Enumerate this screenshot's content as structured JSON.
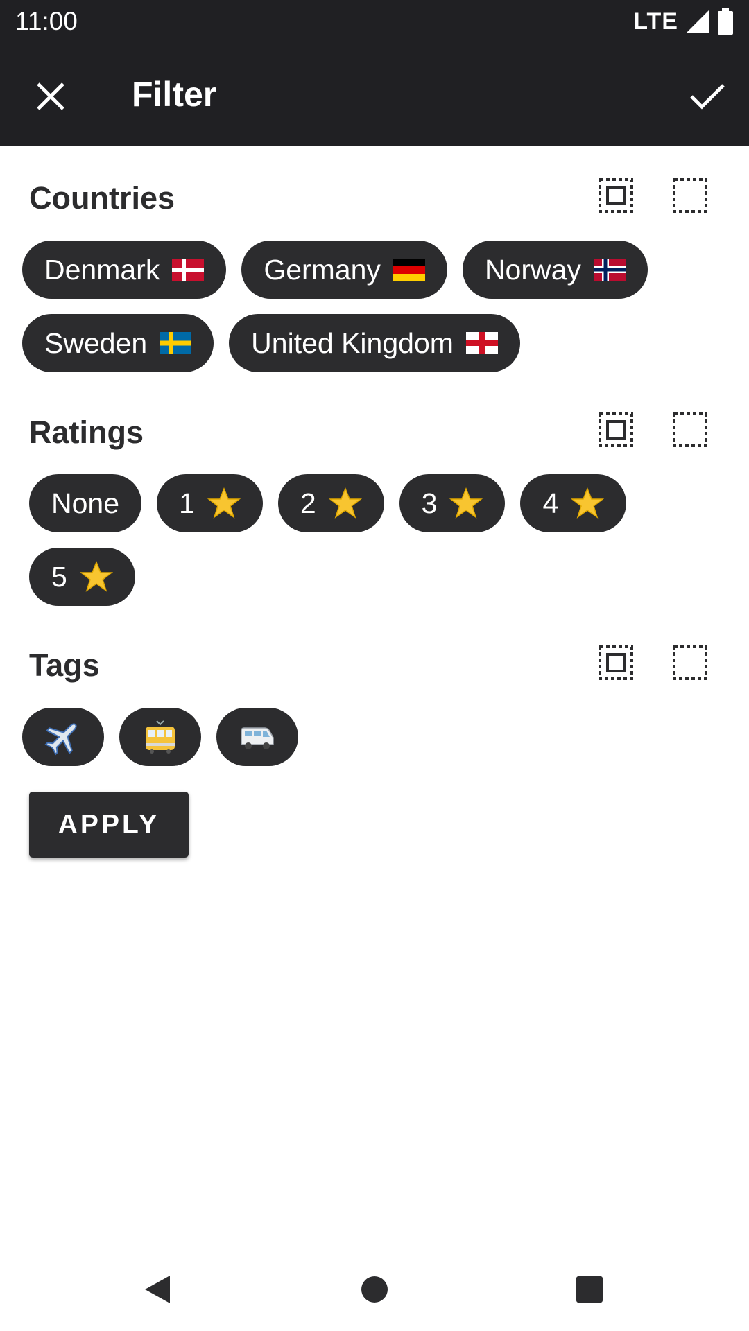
{
  "status_bar": {
    "time": "11:00",
    "network": "LTE"
  },
  "app_bar": {
    "title": "Filter"
  },
  "sections": {
    "countries": {
      "title": "Countries",
      "chips": [
        {
          "label": "Denmark",
          "flag": "denmark-flag-icon"
        },
        {
          "label": "Germany",
          "flag": "germany-flag-icon"
        },
        {
          "label": "Norway",
          "flag": "norway-flag-icon"
        },
        {
          "label": "Sweden",
          "flag": "sweden-flag-icon"
        },
        {
          "label": "United Kingdom",
          "flag": "england-flag-icon"
        }
      ]
    },
    "ratings": {
      "title": "Ratings",
      "chips": [
        {
          "label": "None"
        },
        {
          "label": "1"
        },
        {
          "label": "2"
        },
        {
          "label": "3"
        },
        {
          "label": "4"
        },
        {
          "label": "5"
        }
      ]
    },
    "tags": {
      "title": "Tags",
      "chips": [
        {
          "icon": "airplane-icon"
        },
        {
          "icon": "tram-icon"
        },
        {
          "icon": "van-icon"
        }
      ]
    }
  },
  "apply_label": "APPLY",
  "colors": {
    "bar": "#202023",
    "chip": "#2c2c2e",
    "star": "#f8c530"
  }
}
